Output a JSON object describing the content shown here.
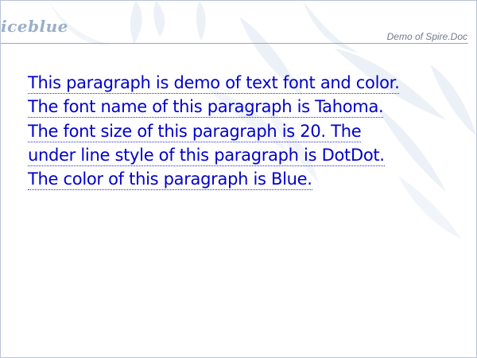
{
  "header": {
    "logo_text": "iceblue",
    "caption": "Demo of Spire.Doc"
  },
  "paragraph": {
    "lines": [
      "This paragraph is demo of text font and color.",
      "The font name of this paragraph is Tahoma.",
      "The font size of this paragraph is 20. The",
      "under line style of this paragraph is DotDot.",
      "The color of this paragraph is Blue."
    ]
  },
  "colors": {
    "text": "#0000cc",
    "logo": "#9aafc8",
    "caption": "#6f7b88"
  }
}
